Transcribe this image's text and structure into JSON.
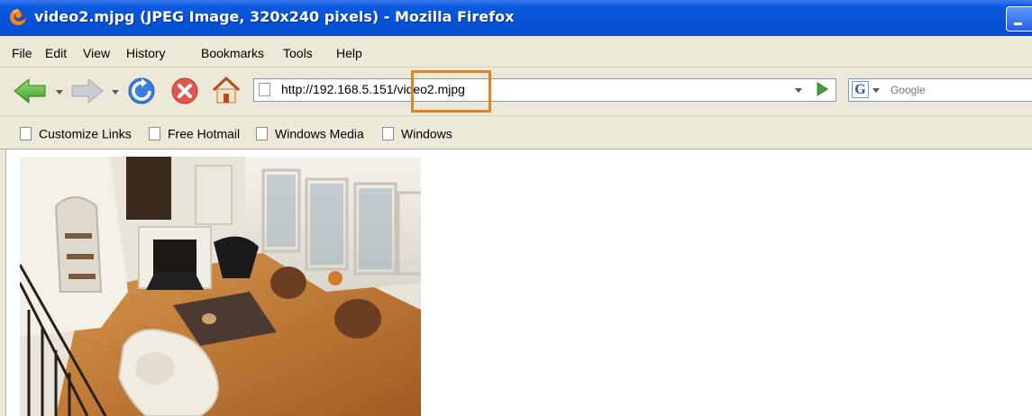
{
  "window": {
    "title": "video2.mjpg (JPEG Image, 320x240 pixels) - Mozilla Firefox"
  },
  "menu": {
    "items": [
      {
        "label": "File"
      },
      {
        "label": "Edit"
      },
      {
        "label": "View"
      },
      {
        "label": "History"
      },
      {
        "label": "Bookmarks"
      },
      {
        "label": "Tools"
      },
      {
        "label": "Help"
      }
    ]
  },
  "navigation": {
    "url_prefix": "http://192.168.5.151/",
    "url_highlight": "video2.mjpg",
    "search_placeholder": "Google",
    "search_engine_icon": "G"
  },
  "bookmarks": [
    {
      "label": "Customize Links"
    },
    {
      "label": "Free Hotmail"
    },
    {
      "label": "Windows Media"
    },
    {
      "label": "Windows"
    }
  ],
  "colors": {
    "highlight_box": "#e08421",
    "titlebar": "#0552d8"
  },
  "content": {
    "image_subject": "overhead view of living room"
  }
}
